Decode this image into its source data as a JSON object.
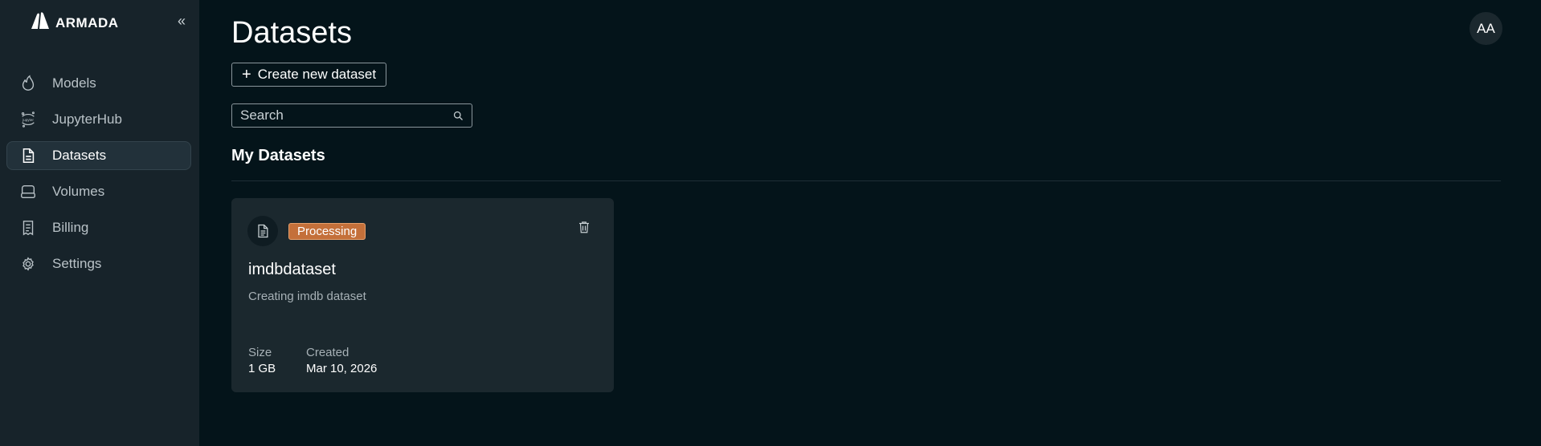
{
  "brand": {
    "name": "ARMADA"
  },
  "sidebar": {
    "collapse_icon": "«",
    "items": [
      {
        "label": "Models",
        "icon": "flame-icon",
        "active": false
      },
      {
        "label": "JupyterHub",
        "icon": "jupyter-icon",
        "active": false
      },
      {
        "label": "Datasets",
        "icon": "file-icon",
        "active": true
      },
      {
        "label": "Volumes",
        "icon": "drive-icon",
        "active": false
      },
      {
        "label": "Billing",
        "icon": "receipt-icon",
        "active": false
      },
      {
        "label": "Settings",
        "icon": "gear-icon",
        "active": false
      }
    ]
  },
  "header": {
    "title": "Datasets",
    "avatar_initials": "AA"
  },
  "toolbar": {
    "create_label": "Create new dataset"
  },
  "search": {
    "placeholder": "Search",
    "value": ""
  },
  "section": {
    "title": "My Datasets"
  },
  "datasets": [
    {
      "name": "imdbdataset",
      "description": "Creating imdb dataset",
      "status": "Processing",
      "size_label": "Size",
      "size": "1 GB",
      "created_label": "Created",
      "created": "Mar 10, 2026"
    }
  ],
  "colors": {
    "background": "#04141a",
    "sidebar": "#17232a",
    "card": "#1b282e",
    "status_processing": "#c4703a"
  }
}
